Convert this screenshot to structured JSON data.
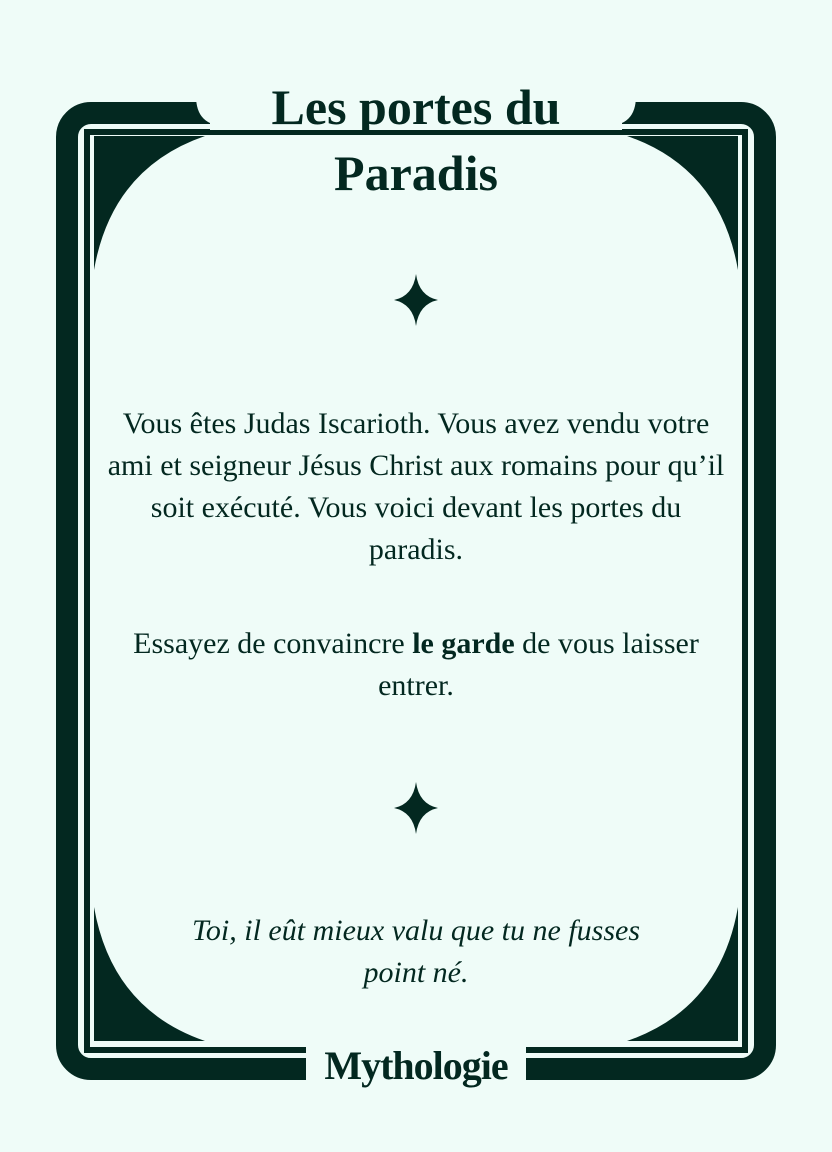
{
  "card": {
    "title": "Les portes du Paradis",
    "paragraph_1": "Vous êtes Judas Iscarioth. Vous avez vendu votre ami et seigneur Jésus Christ aux romains pour qu’il soit exécuté. Vous voici devant les portes du paradis.",
    "paragraph_2": {
      "before": "Essayez de convaincre ",
      "bold": "le garde",
      "after": " de vous laisser entrer."
    },
    "quote": "Toi, il eût mieux valu que tu ne fusses point né.",
    "category": "Mythologie"
  },
  "icons": {
    "top_divider": "four-point-star-icon",
    "bottom_divider": "four-point-star-icon"
  },
  "colors": {
    "background": "#effcf8",
    "ink": "#032820"
  }
}
